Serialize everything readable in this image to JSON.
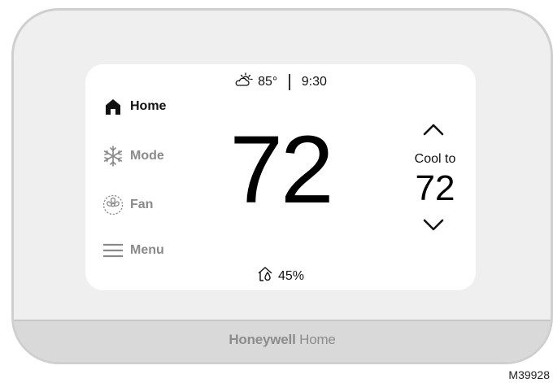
{
  "status": {
    "outdoor_temp": "85°",
    "time": "9:30"
  },
  "nav": {
    "home": "Home",
    "mode": "Mode",
    "fan": "Fan",
    "menu": "Menu"
  },
  "current_temp": "72",
  "humidity": "45%",
  "setpoint": {
    "label": "Cool to",
    "value": "72"
  },
  "brand": {
    "bold": "Honeywell",
    "regular": "Home"
  },
  "figure_id": "M39928",
  "colors": {
    "active_nav": "#111111",
    "inactive_nav": "#8a8a8a",
    "screen_bg": "#ffffff",
    "bezel": "#efefef"
  },
  "icons": {
    "weather": "partly-cloudy-icon",
    "home": "house-icon",
    "mode": "snowflake-icon",
    "fan": "fan-icon",
    "menu": "hamburger-icon",
    "humidity": "droplet-home-icon",
    "up": "chevron-up-icon",
    "down": "chevron-down-icon"
  }
}
